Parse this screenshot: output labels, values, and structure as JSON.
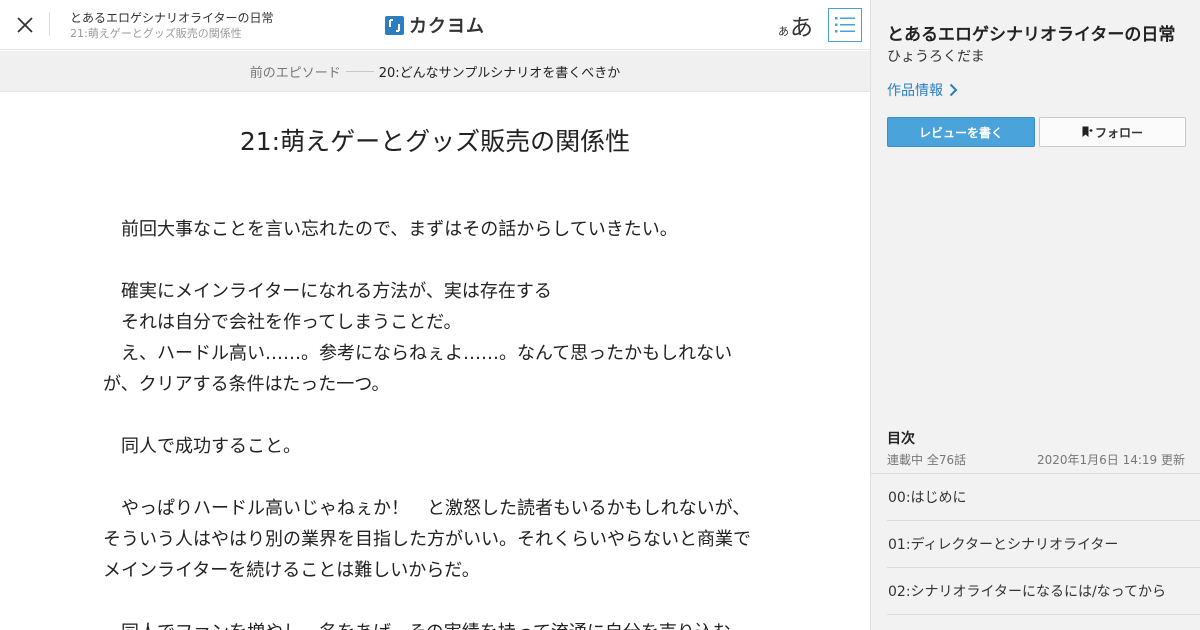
{
  "header": {
    "work_title": "とあるエロゲシナリオライターの日常",
    "episode_title": "21:萌えゲーとグッズ販売の関係性",
    "logo_text": "カクヨム",
    "font_small": "あ",
    "font_large": "あ"
  },
  "nav": {
    "prev_label": "前のエピソード",
    "prev_title": "20:どんなサンプルシナリオを書くべきか"
  },
  "main": {
    "title": "21:萌えゲーとグッズ販売の関係性",
    "lines": [
      "　前回大事なことを言い忘れたので、まずはその話からしていきたい。",
      "",
      "　確実にメインライターになれる方法が、実は存在する",
      "　それは自分で会社を作ってしまうことだ。",
      "　え、ハードル高い……。参考にならねぇよ……。なんて思ったかもしれない",
      "が、クリアする条件はたった一つ。",
      "",
      "　同人で成功すること。",
      "",
      "　やっぱりハードル高いじゃねぇか！　と激怒した読者もいるかもしれないが、",
      "そういう人はやはり別の業界を目指した方がいい。それくらいやらないと商業で",
      "メインライターを続けることは難しいからだ。",
      "",
      "　同人でファンを増やし、名をあげ、その実績を持って流通に自分を売り込む"
    ]
  },
  "sidebar": {
    "title": "とあるエロゲシナリオライターの日常",
    "author": "ひょうろくだま",
    "info_link": "作品情報",
    "review_button": "レビューを書く",
    "follow_button": "フォロー",
    "toc_heading": "目次",
    "toc_status": "連載中 全76話",
    "toc_updated": "2020年1月6日 14:19 更新",
    "toc_items": [
      "00:はじめに",
      "01:ディレクターとシナリオライター",
      "02:シナリオライターになるには/なってから"
    ]
  },
  "colors": {
    "accent": "#2b7fc1",
    "review_button": "#4aa3da"
  }
}
